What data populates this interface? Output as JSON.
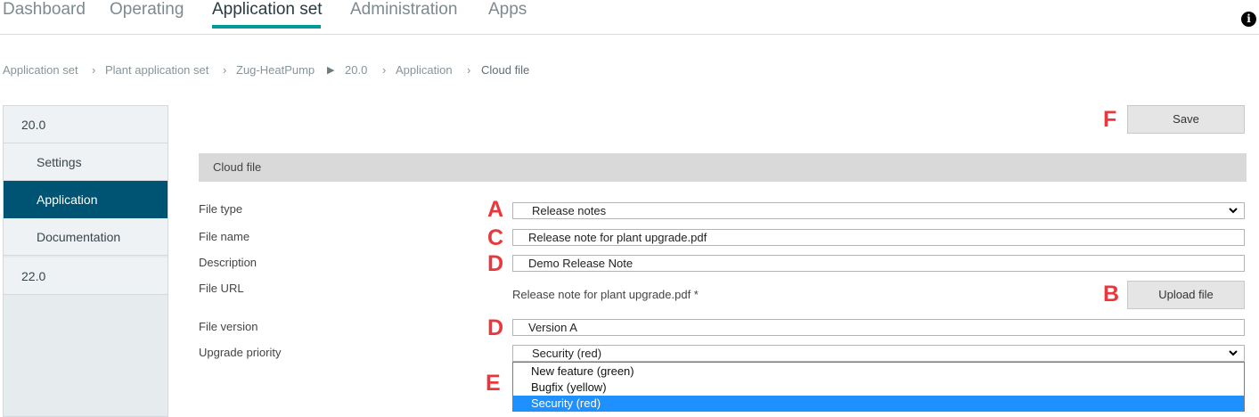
{
  "nav": {
    "tabs": [
      {
        "label": "Dashboard"
      },
      {
        "label": "Operating"
      },
      {
        "label": "Application set",
        "active": true
      },
      {
        "label": "Administration"
      },
      {
        "label": "Apps"
      }
    ],
    "info_icon": "info-icon",
    "info_glyph": "i",
    "accent_color": "#009999"
  },
  "breadcrumb": {
    "items": [
      "Application set",
      "Plant application set",
      "Zug-HeatPump",
      "20.0",
      "Application",
      "Cloud file"
    ],
    "separators": [
      "›",
      "›",
      "›",
      "▶",
      "›",
      "›"
    ]
  },
  "sidebar": {
    "items": [
      {
        "label": "20.0"
      },
      {
        "label": "Settings"
      },
      {
        "label": "Application",
        "selected": true
      },
      {
        "label": "Documentation"
      },
      {
        "label": "22.0"
      }
    ],
    "selected_color": "#005473"
  },
  "toolbar": {
    "save_label": "Save"
  },
  "section": {
    "title": "Cloud file"
  },
  "form": {
    "file_type": {
      "label": "File type",
      "value": "Release notes"
    },
    "file_name": {
      "label": "File name",
      "value": "Release note for plant upgrade.pdf"
    },
    "description": {
      "label": "Description",
      "value": "Demo Release Note"
    },
    "file_url": {
      "label": "File URL",
      "value": "Release note for plant upgrade.pdf *",
      "upload_label": "Upload file"
    },
    "file_version": {
      "label": "File version",
      "value": "Version A"
    },
    "upgrade_priority": {
      "label": "Upgrade priority",
      "value": "Security (red)",
      "options": [
        "New feature (green)",
        "Bugfix (yellow)",
        "Security (red)"
      ],
      "highlighted": "Security (red)"
    }
  },
  "markers": {
    "A": "A",
    "B": "B",
    "C": "C",
    "D1": "D",
    "D2": "D",
    "E": "E",
    "F": "F"
  },
  "icons": {
    "chevron": "chevron-down-icon",
    "chevron_glyph": "⌄"
  },
  "colors": {
    "marker": "#e8373d",
    "highlight": "#1e90ff"
  }
}
